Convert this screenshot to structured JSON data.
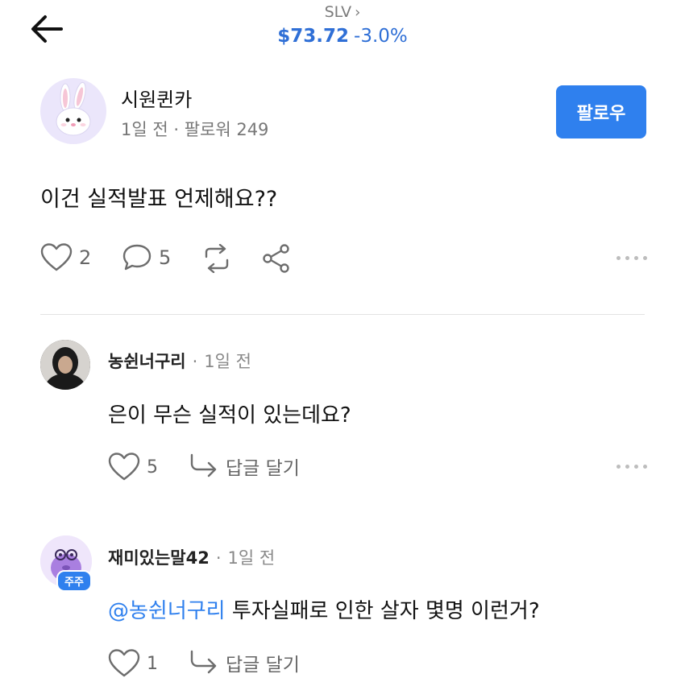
{
  "header": {
    "ticker": "SLV",
    "ticker_chevron": "›",
    "price": "$73.72",
    "change": "-3.0%",
    "back_icon": "arrow-left-icon"
  },
  "post": {
    "author": "시원퀸카",
    "meta": "1일 전 · 팔로워 249",
    "follow_label": "팔로우",
    "body": "이건 실적발표 언제해요??",
    "likes": "2",
    "comments": "5"
  },
  "comments": [
    {
      "name": "농쉰너구리",
      "sep": "·",
      "time": "1일 전",
      "body": "은이 무슨 실적이 있는데요?",
      "likes": "5",
      "reply_label": "답글 달기"
    },
    {
      "name": "재미있는말42",
      "sep": "·",
      "time": "1일 전",
      "badge": "주주",
      "mention": "@농쉰너구리",
      "body": " 투자실패로 인한 살자 몇명 이런거?",
      "likes": "1",
      "reply_label": "답글 달기"
    }
  ],
  "colors": {
    "accent": "#2f80ee",
    "price": "#2f6fd6",
    "muted": "#777777"
  }
}
